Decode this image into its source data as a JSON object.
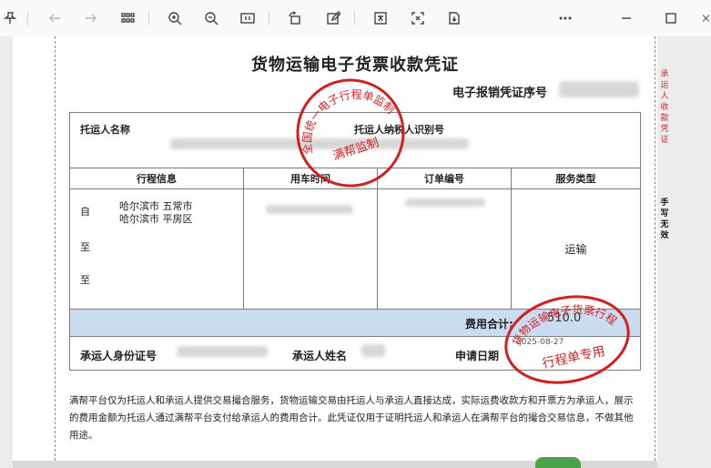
{
  "toolbar": {
    "buttons": [
      {
        "name": "pin-icon",
        "glyph": "⚲"
      },
      {
        "name": "back-icon",
        "glyph": "←"
      },
      {
        "name": "forward-icon",
        "glyph": "→"
      },
      {
        "name": "page-grid-icon",
        "glyph": "▦"
      },
      {
        "name": "zoom-in-icon",
        "glyph": "⊕"
      },
      {
        "name": "zoom-out-icon",
        "glyph": "⊖"
      },
      {
        "name": "fit-page-icon",
        "glyph": "▭"
      },
      {
        "name": "rotate-icon",
        "glyph": "↺"
      },
      {
        "name": "edit-icon",
        "glyph": "✎"
      },
      {
        "name": "translate-icon",
        "glyph": "文"
      },
      {
        "name": "screenshot-icon",
        "glyph": "⛶"
      },
      {
        "name": "save-icon",
        "glyph": "⭳"
      },
      {
        "name": "more-icon",
        "glyph": "…"
      },
      {
        "name": "minimize-icon",
        "glyph": "—"
      },
      {
        "name": "maximize-icon",
        "glyph": "☐"
      },
      {
        "name": "close-icon",
        "glyph": "✕"
      }
    ]
  },
  "document": {
    "title": "货物运输电子货票收款凭证",
    "serial_label": "电子报销凭证序号",
    "side_right_top": "承运人收款凭证",
    "side_right_bottom": "手写无效",
    "shipper_name_label": "托运人名称",
    "shipper_tax_label": "托运人纳税人识别号",
    "headers": {
      "route": "行程信息",
      "time": "用车时间",
      "order": "订单编号",
      "service": "服务类型"
    },
    "route": {
      "from_label": "自",
      "from_value": "哈尔滨市 五常市",
      "to_label_1": "至",
      "to_value": "哈尔滨市 平房区",
      "to_label_2": "至"
    },
    "service_value": "运输",
    "total_label": "费用合计:",
    "total_value": "510.0",
    "carrier_id_label": "承运人身份证号",
    "carrier_name_label": "承运人姓名",
    "apply_date_label": "申请日期",
    "apply_date_value": "2025-08-27",
    "footnote": "满帮平台仅为托运人和承运人提供交易撮合服务，货物运输交易由托运人与承运人直接达成，实际运费收款方和开票方为承运人，展示的费用金额为托运人通过满帮平台支付给承运人的费用合计。此凭证仅用于证明托运人和承运人在满帮平台的撮合交易信息，不做其他用途。"
  },
  "stamps": {
    "top_ring_text": "全国统一电子行程单监制",
    "top_center_text": "满帮监制",
    "bottom_ring_text": "货物运输电子货票行程单",
    "bottom_center_text": "行程单专用"
  },
  "colors": {
    "stamp_red": "#d02020",
    "total_band": "#c9dcf0"
  }
}
